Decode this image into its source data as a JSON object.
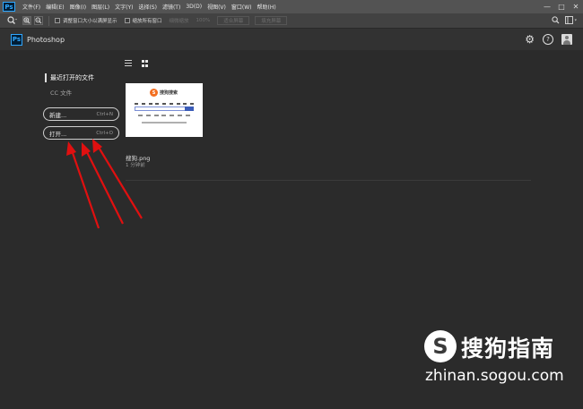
{
  "menubar": {
    "logo": "Ps",
    "items": [
      "文件(F)",
      "编辑(E)",
      "图像(I)",
      "图层(L)",
      "文字(Y)",
      "选择(S)",
      "滤镜(T)",
      "3D(D)",
      "视图(V)",
      "窗口(W)",
      "帮助(H)"
    ],
    "window_controls": {
      "minimize": "—",
      "maximize": "□",
      "close": "✕"
    }
  },
  "optionsbar": {
    "tool_icon": "zoom-tool-icon",
    "zoom_in": "+",
    "zoom_out": "−",
    "resize_windows_label": "调整窗口大小以满屏显示",
    "zoom_all_windows_label": "缩放所有窗口",
    "scrubby_zoom_label": "细微缩放",
    "zoom_percent": "100%",
    "fit_screen_label": "适合屏幕",
    "fill_screen_label": "填充屏幕"
  },
  "header": {
    "app_icon": "Ps",
    "app_name": "Photoshop",
    "gear_glyph": "⚙",
    "help_glyph": "?"
  },
  "start": {
    "recent_title": "最近打开的文件",
    "cc_files": "CC 文件",
    "new_label": "新建...",
    "new_shortcut": "Ctrl+N",
    "open_label": "打开...",
    "open_shortcut": "Ctrl+O"
  },
  "recent_files": [
    {
      "name": "搜狗.png",
      "time": "1 分钟前",
      "thumb_logo_text": "搜狗搜索",
      "thumb_logo_mark": "S"
    }
  ],
  "watermark": {
    "logo_glyph": "S",
    "brand": "搜狗指南",
    "url": "zhinan.sogou.com"
  },
  "colors": {
    "annotation_arrow": "#e01010",
    "ps_blue": "#31a8ff",
    "background": "#2b2b2b"
  }
}
